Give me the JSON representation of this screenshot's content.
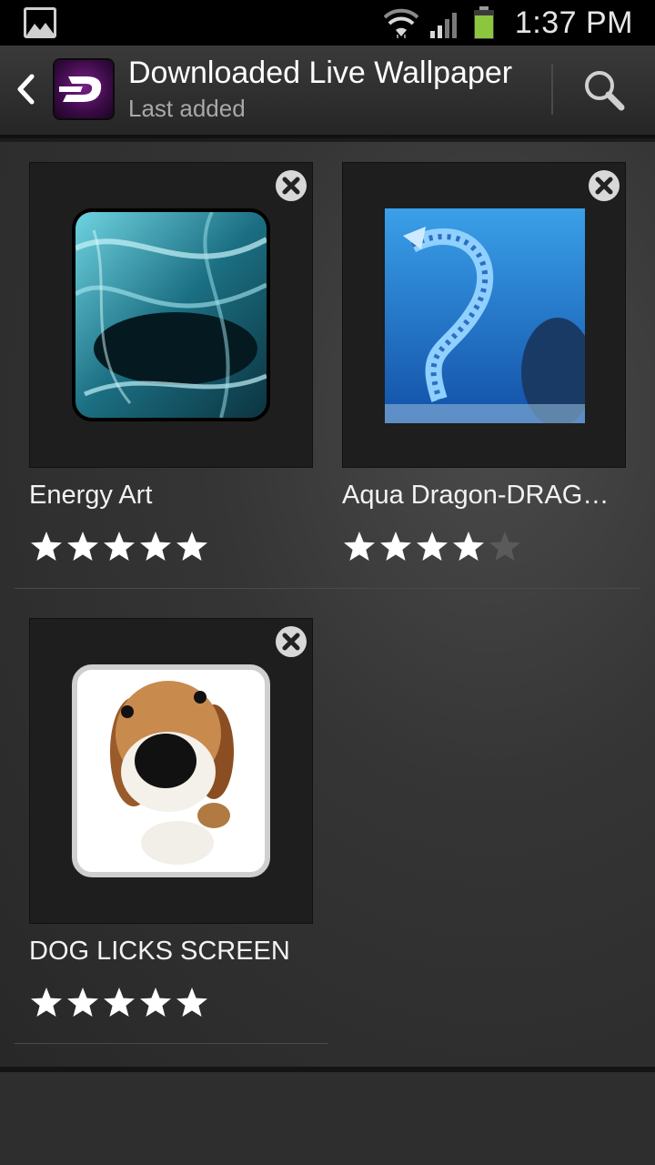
{
  "status_bar": {
    "time": "1:37 PM",
    "icons": [
      "gallery-notification-icon",
      "wifi-icon",
      "signal-icon",
      "battery-icon"
    ]
  },
  "action_bar": {
    "title": "Downloaded Live Wallpaper",
    "subtitle": "Last added",
    "icons": [
      "back-icon",
      "zedge-app-icon",
      "search-icon"
    ]
  },
  "items": [
    {
      "name": "Energy Art",
      "rating": 5,
      "max_rating": 5,
      "thumbnail": "energy-art-thumbnail"
    },
    {
      "name": "Aqua Dragon-DRAG…",
      "rating": 4,
      "max_rating": 5,
      "thumbnail": "aqua-dragon-thumbnail"
    },
    {
      "name": "DOG LICKS SCREEN",
      "rating": 5,
      "max_rating": 5,
      "thumbnail": "dog-licks-screen-thumbnail"
    }
  ],
  "colors": {
    "star_filled": "#ffffff",
    "star_empty": "#5a5a5a",
    "battery": "#8cc63f",
    "app_icon": "#5c1670"
  }
}
